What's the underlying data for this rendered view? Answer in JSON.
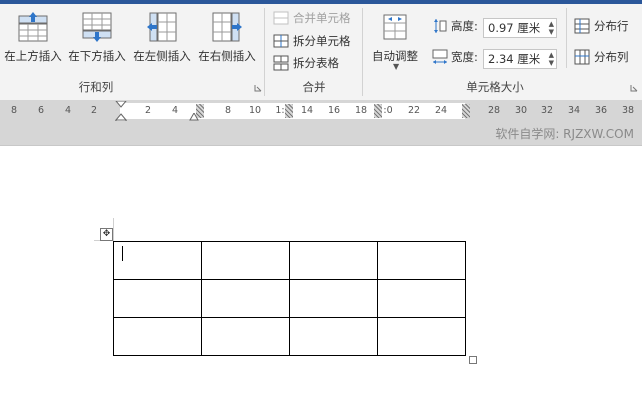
{
  "ribbon": {
    "rows_cols": {
      "insert_above": "在上方插入",
      "insert_below": "在下方插入",
      "insert_left": "在左侧插入",
      "insert_right": "在右侧插入",
      "group_label": "行和列"
    },
    "merge": {
      "merge_cells": "合并单元格",
      "split_cells": "拆分单元格",
      "split_table": "拆分表格",
      "group_label": "合并"
    },
    "cell_size": {
      "autofit": "自动调整",
      "height_label": "高度:",
      "height_value": "0.97 厘米",
      "width_label": "宽度:",
      "width_value": "2.34 厘米",
      "distribute_rows": "分布行",
      "distribute_cols": "分布列",
      "group_label": "单元格大小"
    }
  },
  "ruler": {
    "ticks": [
      "8",
      "6",
      "4",
      "2",
      "2",
      "4",
      "8",
      "10",
      "1:",
      "14",
      "16",
      "18",
      ":0",
      "22",
      "24",
      "28",
      "30",
      "32",
      "34",
      "36",
      "38"
    ]
  },
  "watermark": "软件自学网: RJZXW.COM",
  "colors": {
    "accent": "#2b579a",
    "ribbon_bg": "#f3f3f3",
    "ruler_bg": "#d6d6d6"
  }
}
